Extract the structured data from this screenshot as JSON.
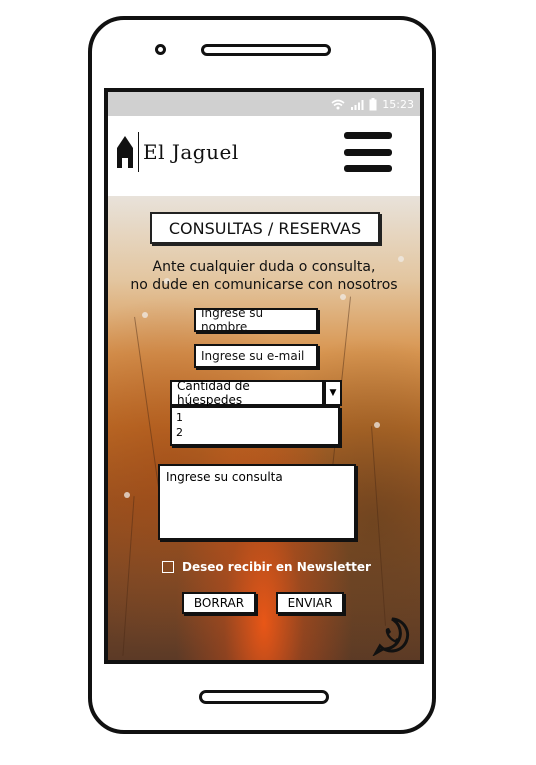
{
  "status_bar": {
    "time": "15:23"
  },
  "header": {
    "logo_text": "El Jaguel"
  },
  "form": {
    "title": "CONSULTAS / RESERVAS",
    "intro_line1": "Ante cualquier duda o consulta,",
    "intro_line2": "no dude en comunicarse con nosotros",
    "name_placeholder": "Ingrese su nombre",
    "email_placeholder": "Ingrese su e-mail",
    "guests_select": {
      "selected": "Cantidad de húespedes",
      "options": [
        "1",
        "2"
      ]
    },
    "message_placeholder": "Ingrese su consulta",
    "newsletter_label": "Deseo recibir en Newsletter",
    "reset_label": "BORRAR",
    "submit_label": "ENVIAR"
  },
  "icons": {
    "wifi": "wifi-icon",
    "signal": "signal-icon",
    "battery": "battery-icon",
    "home": "house-icon",
    "menu": "hamburger-menu-icon",
    "whatsapp": "whatsapp-icon"
  }
}
